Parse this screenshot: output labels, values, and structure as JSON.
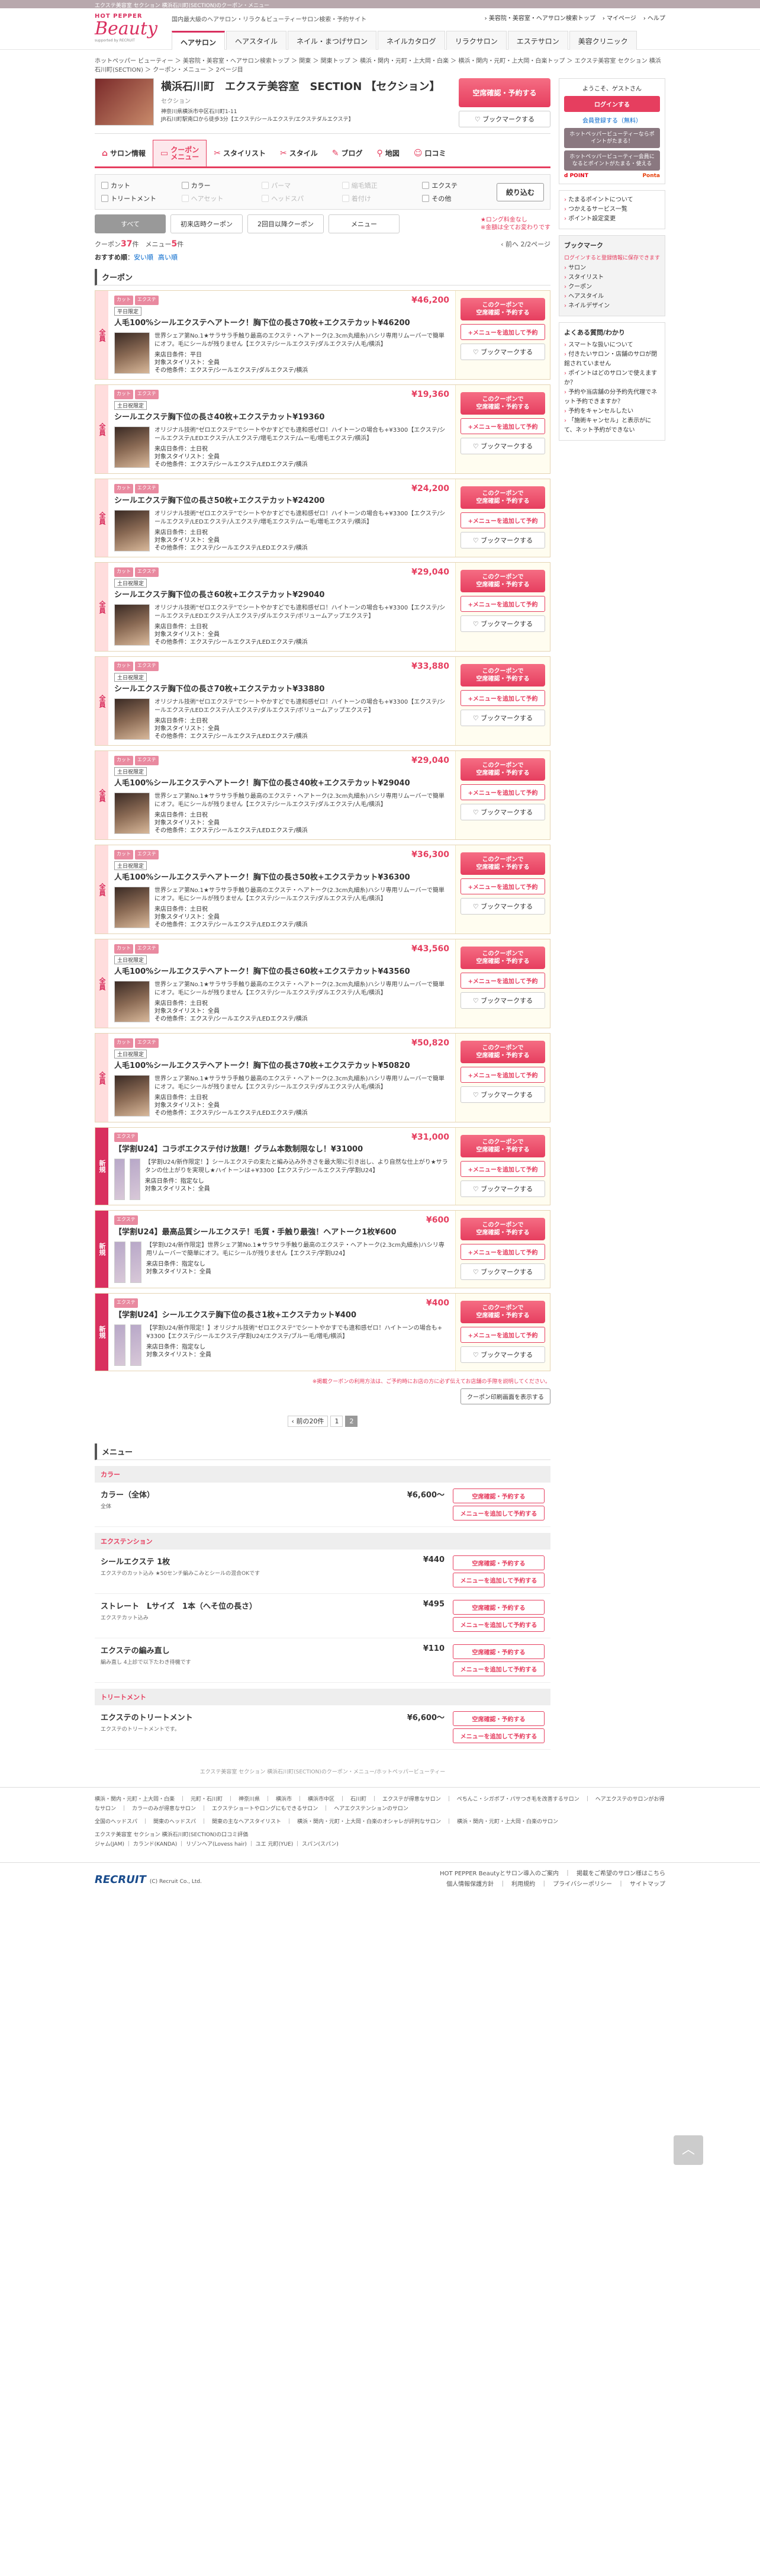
{
  "topbar": "エクステ美容室 セクション 横浜石川町(SECTION)のクーポン・メニュー",
  "header": {
    "tagline": "国内最大級のヘアサロン・リラク＆ビューティーサロン検索・予約サイト",
    "right": [
      "› 美容院・美容室・ヘアサロン検索トップ",
      "› マイページ",
      "› ヘルプ"
    ],
    "logo": {
      "hp": "HOT PEPPER",
      "beauty": "Beauty",
      "sub": "supported by RECRUIT"
    }
  },
  "gnav": [
    "ヘアサロン",
    "ヘアスタイル",
    "ネイル・まつげサロン",
    "ネイルカタログ",
    "リラクサロン",
    "エステサロン",
    "美容クリニック"
  ],
  "breadcrumb": "ホットペッパー ビューティー ＞ 美容院・美容室・ヘアサロン検索トップ ＞ 関東 ＞ 関東トップ ＞ 横浜・関内・元町・上大岡・白楽 ＞ 横浜・関内・元町・上大岡・白楽トップ ＞ エクステ美容室 セクション 横浜石川町(SECTION) ＞ クーポン・メニュー ＞ 2ページ目",
  "salon": {
    "name": "横浜石川町　エクステ美容室　SECTION 【セクション】",
    "kana": "セクション",
    "addr1": "神奈川県横浜市中区石川町1-11",
    "addr2": "JR石川町駅南口から徒歩3分【エクステ/シールエクステ/エクステダルエクステ】",
    "book": "空席確認・予約する",
    "bookmark": "ブックマークする"
  },
  "tabs": [
    {
      "icon": "⌂",
      "label": "サロン情報"
    },
    {
      "icon": "▭",
      "label": "クーポン\nメニュー"
    },
    {
      "icon": "✂",
      "label": "スタイリスト"
    },
    {
      "icon": "✂",
      "label": "スタイル"
    },
    {
      "icon": "✎",
      "label": "ブログ"
    },
    {
      "icon": "⚲",
      "label": "地図"
    },
    {
      "icon": "☺",
      "label": "口コミ"
    }
  ],
  "filters": [
    {
      "l": "カット",
      "d": false
    },
    {
      "l": "カラー",
      "d": false
    },
    {
      "l": "パーマ",
      "d": true
    },
    {
      "l": "縮毛矯正",
      "d": true
    },
    {
      "l": "エクステ",
      "d": false
    },
    {
      "l": "トリートメント",
      "d": false
    },
    {
      "l": "ヘアセット",
      "d": true
    },
    {
      "l": "ヘッドスパ",
      "d": true
    },
    {
      "l": "着付け",
      "d": true
    },
    {
      "l": "その他",
      "d": false
    }
  ],
  "filter_btn": "絞り込む",
  "types": [
    "すべて",
    "初来店時クーポン",
    "2回目以降クーポン",
    "メニュー"
  ],
  "rare": "★ロング料金なし\n※金額は全てお変わりです",
  "count": {
    "coupon_label": "クーポン",
    "coupon": "37",
    "menu_label": "メニュー",
    "menu": "5",
    "unit": "件",
    "nav": "‹ 前へ  2/2ページ"
  },
  "sort": {
    "label": "おすすめ順",
    "opts": [
      "安い順",
      "高い順"
    ]
  },
  "section_title": "クーポン",
  "coupons": [
    {
      "side": "全員",
      "tags": [
        "カット",
        "エクステ"
      ],
      "price": "¥46,200",
      "limit": "平日限定",
      "title": "人毛100%シールエクステヘアトーク！胸下位の長さ70枚+エクステカット¥46200",
      "desc": "世界シェア第No.1★サラサラ手触り最高のエクステ・ヘアトーク(2.3cm丸細糸)ハシリ専用リムーバーで簡単にオフ。毛にシールが残りません【エクステ/シールエクステ/ダルエクステ/人毛/横浜】",
      "meta": [
        "来店日条件：平日",
        "対象スタイリスト：全員",
        "その他条件：エクステ/シールエクステ/ダルエクステ/横浜"
      ]
    },
    {
      "side": "全員",
      "tags": [
        "カット",
        "エクステ"
      ],
      "price": "¥19,360",
      "limit": "土日祝限定",
      "title": "シールエクステ胸下位の長さ40枚+エクステカット¥19360",
      "desc": "オリジナル技術\"ゼロエクステ\"でシートやかすどでも違和感ゼロ！ハイトーンの場合も+¥3300【エクステ/シールエクステ/LEDエクステ/人エクステ/増毛エクステ/ムー毛/増毛エクステ/横浜】",
      "meta": [
        "来店日条件：土日祝",
        "対象スタイリスト：全員",
        "その他条件：エクステ/シールエクステ/LEDエクステ/横浜"
      ]
    },
    {
      "side": "全員",
      "tags": [
        "カット",
        "エクステ"
      ],
      "price": "¥24,200",
      "limit": "",
      "title": "シールエクステ胸下位の長さ50枚+エクステカット¥24200",
      "desc": "オリジナル技術\"ゼロエクステ\"でシートやかすどでも違和感ゼロ！ハイトーンの場合も+¥3300【エクステ/シールエクステ/LEDエクステ/人エクステ/増毛エクステ/ムー毛/増毛エクステ/横浜】",
      "meta": [
        "来店日条件：土日祝",
        "対象スタイリスト：全員",
        "その他条件：エクステ/シールエクステ/LEDエクステ/横浜"
      ]
    },
    {
      "side": "全員",
      "tags": [
        "カット",
        "エクステ"
      ],
      "price": "¥29,040",
      "limit": "土日祝限定",
      "title": "シールエクステ胸下位の長さ60枚+エクステカット¥29040",
      "desc": "オリジナル技術\"ゼロエクステ\"でシートやかすどでも違和感ゼロ！ハイトーンの場合も+¥3300【エクステ/シールエクステ/LEDエクステ/人エクステ/ダルエクステ/ボリュームアップエクステ】",
      "meta": [
        "来店日条件：土日祝",
        "対象スタイリスト：全員",
        "その他条件：エクステ/シールエクステ/LEDエクステ/横浜"
      ]
    },
    {
      "side": "全員",
      "tags": [
        "カット",
        "エクステ"
      ],
      "price": "¥33,880",
      "limit": "土日祝限定",
      "title": "シールエクステ胸下位の長さ70枚+エクステカット¥33880",
      "desc": "オリジナル技術\"ゼロエクステ\"でシートやかすどでも違和感ゼロ！ハイトーンの場合も+¥3300【エクステ/シールエクステ/LEDエクステ/人エクステ/ダルエクステ/ボリュームアップエクステ】",
      "meta": [
        "来店日条件：土日祝",
        "対象スタイリスト：全員",
        "その他条件：エクステ/シールエクステ/LEDエクステ/横浜"
      ]
    },
    {
      "side": "全員",
      "tags": [
        "カット",
        "エクステ"
      ],
      "price": "¥29,040",
      "limit": "土日祝限定",
      "title": "人毛100%シールエクステヘアトーク！胸下位の長さ40枚+エクステカット¥29040",
      "desc": "世界シェア第No.1★サラサラ手触り最高のエクステ・ヘアトーク(2.3cm丸細糸)ハシリ専用リムーバーで簡単にオフ。毛にシールが残りません【エクステ/シールエクステ/ダルエクステ/人毛/横浜】",
      "meta": [
        "来店日条件：土日祝",
        "対象スタイリスト：全員",
        "その他条件：エクステ/シールエクステ/LEDエクステ/横浜"
      ]
    },
    {
      "side": "全員",
      "tags": [
        "カット",
        "エクステ"
      ],
      "price": "¥36,300",
      "limit": "土日祝限定",
      "title": "人毛100%シールエクステヘアトーク！胸下位の長さ50枚+エクステカット¥36300",
      "desc": "世界シェア第No.1★サラサラ手触り最高のエクステ・ヘアトーク(2.3cm丸細糸)ハシリ専用リムーバーで簡単にオフ。毛にシールが残りません【エクステ/シールエクステ/ダルエクステ/人毛/横浜】",
      "meta": [
        "来店日条件：土日祝",
        "対象スタイリスト：全員",
        "その他条件：エクステ/シールエクステ/LEDエクステ/横浜"
      ]
    },
    {
      "side": "全員",
      "tags": [
        "カット",
        "エクステ"
      ],
      "price": "¥43,560",
      "limit": "土日祝限定",
      "title": "人毛100%シールエクステヘアトーク！胸下位の長さ60枚+エクステカット¥43560",
      "desc": "世界シェア第No.1★サラサラ手触り最高のエクステ・ヘアトーク(2.3cm丸細糸)ハシリ専用リムーバーで簡単にオフ。毛にシールが残りません【エクステ/シールエクステ/ダルエクステ/人毛/横浜】",
      "meta": [
        "来店日条件：土日祝",
        "対象スタイリスト：全員",
        "その他条件：エクステ/シールエクステ/LEDエクステ/横浜"
      ]
    },
    {
      "side": "全員",
      "tags": [
        "カット",
        "エクステ"
      ],
      "price": "¥50,820",
      "limit": "土日祝限定",
      "title": "人毛100%シールエクステヘアトーク！胸下位の長さ70枚+エクステカット¥50820",
      "desc": "世界シェア第No.1★サラサラ手触り最高のエクステ・ヘアトーク(2.3cm丸細糸)ハシリ専用リムーバーで簡単にオフ。毛にシールが残りません【エクステ/シールエクステ/ダルエクステ/人毛/横浜】",
      "meta": [
        "来店日条件：土日祝",
        "対象スタイリスト：全員",
        "その他条件：エクステ/シールエクステ/LEDエクステ/横浜"
      ]
    },
    {
      "side": "新規",
      "tags": [
        "エクステ"
      ],
      "price": "¥31,000",
      "limit": "",
      "title": "【学割U24】コラボエクステ付け放題！グラム本数制限なし！¥31000",
      "desc": "【学割U24/新作限定！】シールエクステの束たと編み込み外きさを最大限に引き出し、より自然な仕上がり★サラタンの仕上がりを実現し★ハイトーンは+¥3300【エクステ/シールエクステ/学割U24】",
      "meta": [
        "来店日条件：指定なし",
        "対象スタイリスト：全員"
      ]
    },
    {
      "side": "新規",
      "tags": [
        "エクステ"
      ],
      "price": "¥600",
      "limit": "",
      "title": "【学割U24】最高品質シールエクステ！毛質・手触り最強！ヘアトーク1枚¥600",
      "desc": "【学割U24/新作限定】世界シェア第No.1★サラサラ手触り最高のエクステ・ヘアトーク(2.3cm丸細糸)ハシリ専用リムーバーで簡単にオフ。毛にシールが残りません【エクステ/学割U24】",
      "meta": [
        "来店日条件：指定なし",
        "対象スタイリスト：全員"
      ]
    },
    {
      "side": "新規",
      "tags": [
        "エクステ"
      ],
      "price": "¥400",
      "limit": "",
      "title": "【学割U24】シールエクステ胸下位の長さ1枚+エクステカット¥400",
      "desc": "【学割U24/新作限定！】オリジナル技術\"ゼロエクステ\"でシートやかすでも違和感ゼロ！ハイトーンの場合も+¥3300【エクステ/シールエクステ/学割U24/エクステ/ブルー毛/増毛/横浜】",
      "meta": [
        "来店日条件：指定なし",
        "対象スタイリスト：全員"
      ]
    }
  ],
  "coupon_btns": {
    "book": "このクーポンで\n空席確認・予約する",
    "select": "+メニューを追加して予約",
    "bookmark": "ブックマークする"
  },
  "note": "※掲載クーポンの利用方法は、ご予約時にお店の方に必ず伝えてお店舗の手際を説明してください。",
  "print": "クーポン印刷画面を表示する",
  "pager": {
    "prev": "‹ 前の20件",
    "pages": [
      "1",
      "2"
    ]
  },
  "menu": {
    "title": "メニュー",
    "cats": [
      {
        "name": "カラー",
        "items": [
          {
            "n": "カラー（全体）",
            "d": "全体",
            "p": "¥6,600〜"
          }
        ]
      },
      {
        "name": "エクステンション",
        "items": [
          {
            "n": "シールエクステ 1枚",
            "d": "エクステのカット込み ★50センチ編みこみとシールの混合OKです",
            "p": "¥440"
          },
          {
            "n": "ストレート　Lサイズ　1本（へそ位の長さ）",
            "d": "エクステカット込み",
            "p": "¥495"
          },
          {
            "n": "エクステの編み直し",
            "d": "編み直し 4上診で以下たわき待機です",
            "p": "¥110"
          }
        ]
      },
      {
        "name": "トリートメント",
        "items": [
          {
            "n": "エクステのトリートメント",
            "d": "エクステのトリートメントです。",
            "p": "¥6,600〜"
          }
        ]
      }
    ],
    "b1": "空席確認・予約する",
    "b2": "メニューを追加して予約する"
  },
  "menu_foot": "エクステ美容室 セクション 横浜石川町(SECTION)のクーポン・メニュー/ホットペッパービューティー",
  "side": {
    "welcome": "ようこそ、ゲストさん",
    "login": "ログインする",
    "register": "会員登録する（無料）",
    "sign1": "ホットペッパービューティーならポイントがたまる！",
    "sign2": "ホットペッパービューティー会員になるとポイントがたまる・使える",
    "pay_a": "d POINT",
    "pay_b": "Ponta",
    "links1": [
      "たまるポイントについて",
      "つかえるサービス一覧",
      "ポイント設定変更"
    ],
    "bm_title": "ブックマーク",
    "bm_note": "ログインすると登録情報に保存できます",
    "links2": [
      "サロン",
      "スタイリスト",
      "クーポン",
      "ヘアスタイル",
      "ネイルデザイン"
    ],
    "faq_title": "よくある質問/わかり",
    "faq": [
      "スマートな扱いについて",
      "付きたいサロン・店舗のサロが閉館されていません",
      "ポイントはどのサロンで使えますか？",
      "予約や当店舗の分予約先代理でネット予約できますか？",
      "予約をキャンセルしたい",
      "「施術キャンセル」と表示がにて、ネット予約ができない"
    ]
  },
  "footer": {
    "l1": "横浜・関内・元町・上大岡・白楽　｜　元町・石川町　｜　神奈川県　｜　横浜市　｜　横浜市中区　｜　石川町　｜　エクステが得意なサロン　｜　ぺちんこ・シガボブ・パサつき毛を改善するサロン　｜　ヘアエクステのサロンがお得なサロン　｜　カラーのみが得意なサロン　｜　エクステショートやロングにもできるサロン　｜　ヘアエクステンションのサロン",
    "l2": "全国のヘッドスパ　｜　関東のヘッドスパ　｜　関東の主なヘアスタイリスト　｜　横浜・関内・元町・上大岡・白楽のオシャレが評判なサロン　｜　横浜・関内・元町・上大岡・白楽のサロン",
    "l3": "エクステ美容室 セクション 横浜石川町(SECTION)の口コミ評価",
    "l4": "ジャム(JAM) ｜ カランド(KANDA) ｜ リゾンヘア(Lovess hair) ｜ ユエ 元町(YUE) ｜ スパン(スパン)",
    "recruit": "RECRUIT",
    "copy": "(C) Recruit Co., Ltd.",
    "r1": "HOT PEPPER Beautyとサロン導入のご案内　｜　掲載をご希望のサロン様はこちら",
    "r2": "個人情報保護方針　｜　利用規約　｜　プライバシーポリシー　｜　サイトマップ"
  }
}
